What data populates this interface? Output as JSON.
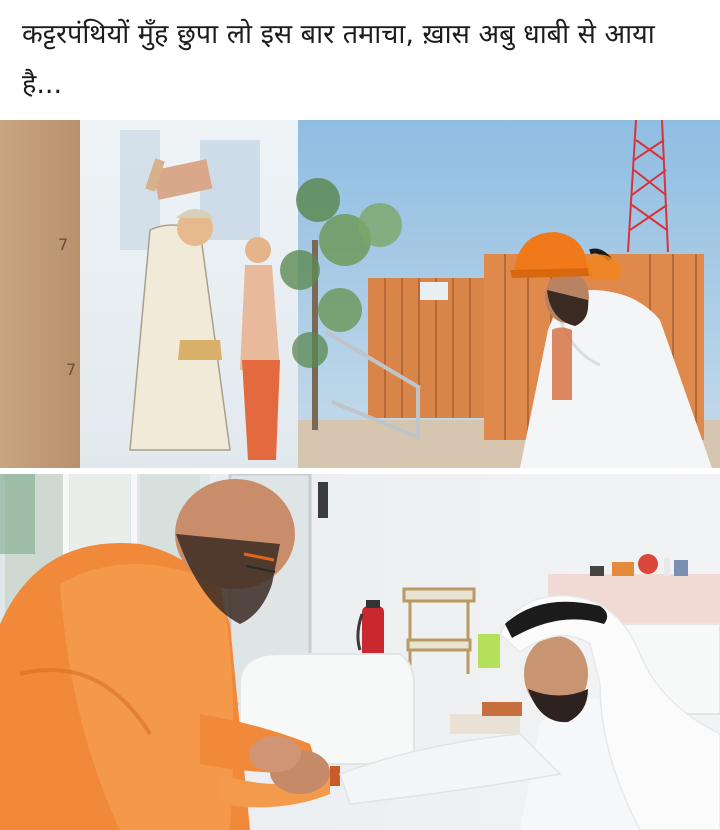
{
  "post": {
    "caption": "कट्टरपंथियों मुँह छुपा लो इस बार तमाचा, ख़ास अबु धाबी से आया है..."
  },
  "photos": [
    {
      "name": "temple-construction-visit-photo"
    },
    {
      "name": "monk-greeting-photo"
    }
  ],
  "colors": {
    "saffron": "#f08a3a",
    "helmet": "#f07a1a",
    "sky": "#9cc4e4",
    "fence": "#d9854a"
  }
}
